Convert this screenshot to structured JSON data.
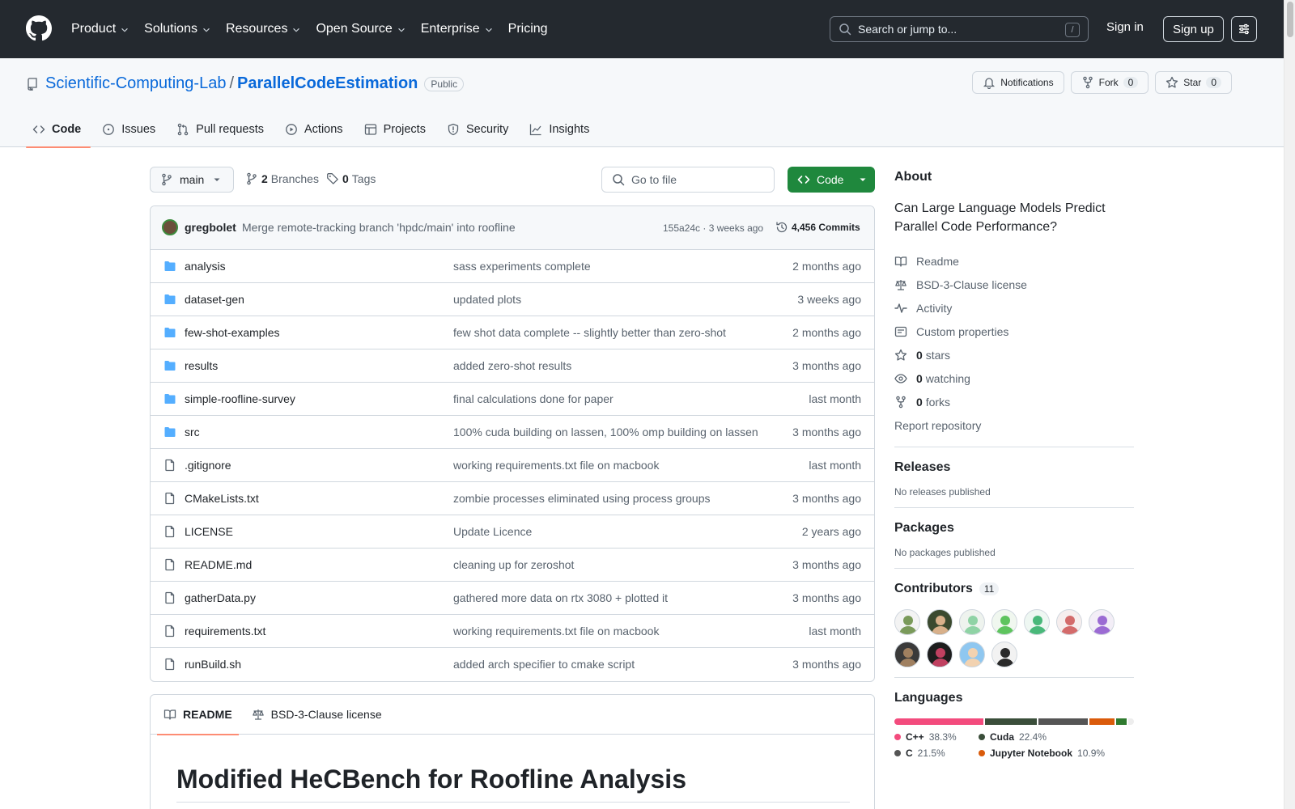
{
  "header": {
    "nav": [
      {
        "label": "Product",
        "dropdown": true
      },
      {
        "label": "Solutions",
        "dropdown": true
      },
      {
        "label": "Resources",
        "dropdown": true
      },
      {
        "label": "Open Source",
        "dropdown": true
      },
      {
        "label": "Enterprise",
        "dropdown": true
      },
      {
        "label": "Pricing",
        "dropdown": false
      }
    ],
    "search_placeholder": "Search or jump to...",
    "search_kbd": "/",
    "signin": "Sign in",
    "signup": "Sign up"
  },
  "repo": {
    "owner": "Scientific-Computing-Lab",
    "name": "ParallelCodeEstimation",
    "visibility": "Public",
    "notifications_label": "Notifications",
    "fork_label": "Fork",
    "fork_count": "0",
    "star_label": "Star",
    "star_count": "0"
  },
  "tabs": [
    {
      "label": "Code",
      "icon": "code-icon",
      "active": true
    },
    {
      "label": "Issues",
      "icon": "issue-icon",
      "active": false
    },
    {
      "label": "Pull requests",
      "icon": "pull-request-icon",
      "active": false
    },
    {
      "label": "Actions",
      "icon": "play-icon",
      "active": false
    },
    {
      "label": "Projects",
      "icon": "table-icon",
      "active": false
    },
    {
      "label": "Security",
      "icon": "shield-icon",
      "active": false
    },
    {
      "label": "Insights",
      "icon": "graph-icon",
      "active": false
    }
  ],
  "branchbar": {
    "branch": "main",
    "branches_count": "2",
    "branches_label": "Branches",
    "tags_count": "0",
    "tags_label": "Tags",
    "goto_placeholder": "Go to file",
    "code_label": "Code"
  },
  "commit": {
    "author": "gregbolet",
    "message": "Merge remote-tracking branch 'hpdc/main' into roofline",
    "hash_time": "155a24c · 3 weeks ago",
    "commits_count": "4,456 Commits"
  },
  "files": [
    {
      "name": "analysis",
      "type": "dir",
      "message": "sass experiments complete",
      "date": "2 months ago"
    },
    {
      "name": "dataset-gen",
      "type": "dir",
      "message": "updated plots",
      "date": "3 weeks ago"
    },
    {
      "name": "few-shot-examples",
      "type": "dir",
      "message": "few shot data complete -- slightly better than zero-shot",
      "date": "2 months ago"
    },
    {
      "name": "results",
      "type": "dir",
      "message": "added zero-shot results",
      "date": "3 months ago"
    },
    {
      "name": "simple-roofline-survey",
      "type": "dir",
      "message": "final calculations done for paper",
      "date": "last month"
    },
    {
      "name": "src",
      "type": "dir",
      "message": "100% cuda building on lassen, 100% omp building on lassen",
      "date": "3 months ago"
    },
    {
      "name": ".gitignore",
      "type": "file",
      "message": "working requirements.txt file on macbook",
      "date": "last month"
    },
    {
      "name": "CMakeLists.txt",
      "type": "file",
      "message": "zombie processes eliminated using process groups",
      "date": "3 months ago"
    },
    {
      "name": "LICENSE",
      "type": "file",
      "message": "Update Licence",
      "date": "2 years ago"
    },
    {
      "name": "README.md",
      "type": "file",
      "message": "cleaning up for zeroshot",
      "date": "3 months ago"
    },
    {
      "name": "gatherData.py",
      "type": "file",
      "message": "gathered more data on rtx 3080 + plotted it",
      "date": "3 months ago"
    },
    {
      "name": "requirements.txt",
      "type": "file",
      "message": "working requirements.txt file on macbook",
      "date": "last month"
    },
    {
      "name": "runBuild.sh",
      "type": "file",
      "message": "added arch specifier to cmake script",
      "date": "3 months ago"
    }
  ],
  "readme": {
    "tab_readme": "README",
    "tab_license": "BSD-3-Clause license",
    "heading": "Modified HeCBench for Roofline Analysis"
  },
  "about": {
    "title": "About",
    "description": "Can Large Language Models Predict Parallel Code Performance?",
    "readme": "Readme",
    "license": "BSD-3-Clause license",
    "activity": "Activity",
    "custom_properties": "Custom properties",
    "stars_count": "0",
    "stars_label": "stars",
    "watching_count": "0",
    "watching_label": "watching",
    "forks_count": "0",
    "forks_label": "forks",
    "report": "Report repository"
  },
  "releases": {
    "title": "Releases",
    "empty": "No releases published"
  },
  "packages": {
    "title": "Packages",
    "empty": "No packages published"
  },
  "contributors": {
    "title": "Contributors",
    "count": "11",
    "avatars": [
      {
        "bg": "#f3f3f3",
        "fg": "#7a9a5a"
      },
      {
        "bg": "#3b4a2f",
        "fg": "#d8b08a"
      },
      {
        "bg": "#eef3ee",
        "fg": "#8fd3a5"
      },
      {
        "bg": "#f0f7ef",
        "fg": "#5ec45e"
      },
      {
        "bg": "#eef7f2",
        "fg": "#49b87a"
      },
      {
        "bg": "#f6eeee",
        "fg": "#d36b6b"
      },
      {
        "bg": "#f3eef7",
        "fg": "#9b6bd3"
      },
      {
        "bg": "#3a3a3a",
        "fg": "#a08060"
      },
      {
        "bg": "#1d1d1d",
        "fg": "#c04060"
      },
      {
        "bg": "#8fc7f0",
        "fg": "#f2d2b0"
      },
      {
        "bg": "#f2f2f2",
        "fg": "#2a2a2a"
      }
    ]
  },
  "languages": {
    "title": "Languages",
    "items": [
      {
        "name": "C++",
        "pct": 38.3,
        "color": "#f34b7d"
      },
      {
        "name": "Cuda",
        "pct": 22.4,
        "color": "#3a4e3a"
      },
      {
        "name": "C",
        "pct": 21.5,
        "color": "#555555"
      },
      {
        "name": "Jupyter Notebook",
        "pct": 10.9,
        "color": "#da5b0b"
      },
      {
        "name": "",
        "pct": 4.5,
        "color": "#2f7a2f"
      },
      {
        "name": "",
        "pct": 2.4,
        "color": "#ededed"
      }
    ],
    "labels": [
      {
        "name": "C++",
        "pct": "38.3%",
        "color": "#f34b7d"
      },
      {
        "name": "Cuda",
        "pct": "22.4%",
        "color": "#3a4e3a"
      },
      {
        "name": "C",
        "pct": "21.5%",
        "color": "#555555"
      },
      {
        "name": "Jupyter Notebook",
        "pct": "10.9%",
        "color": "#da5b0b"
      }
    ]
  }
}
